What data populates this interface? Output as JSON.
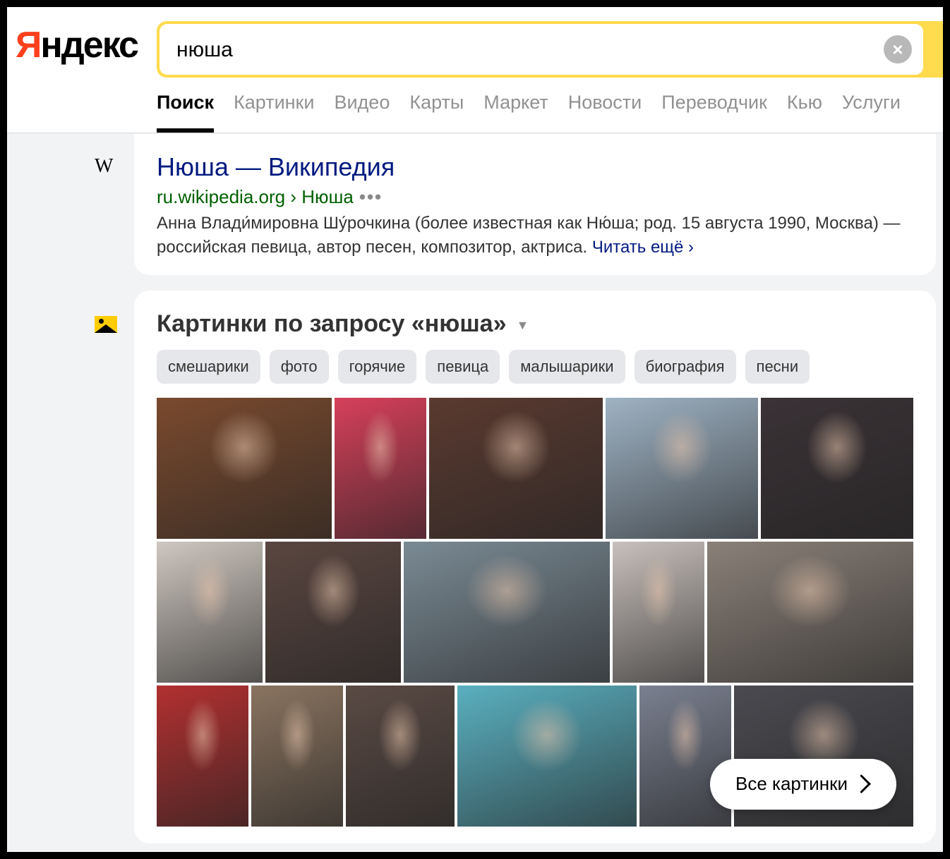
{
  "header": {
    "logo_first": "Я",
    "logo_rest": "ндекс",
    "search_value": "нюша",
    "clear_icon": "×",
    "tabs": [
      {
        "label": "Поиск",
        "active": true
      },
      {
        "label": "Картинки"
      },
      {
        "label": "Видео"
      },
      {
        "label": "Карты"
      },
      {
        "label": "Маркет"
      },
      {
        "label": "Новости"
      },
      {
        "label": "Переводчик"
      },
      {
        "label": "Кью"
      },
      {
        "label": "Услуги"
      }
    ]
  },
  "result": {
    "source_icon": "W",
    "title": "Нюша — Википедия",
    "url_host": "ru.wikipedia.org",
    "url_sep": "›",
    "url_path": "Нюша",
    "url_dots": "•••",
    "snippet": "Анна Влади́мировна Шу́рочкина (более известная как Ню́ша; род. 15 августа 1990, Москва) — российская певица, автор песен, композитор, актриса.",
    "more_label": "Читать ещё ›"
  },
  "images": {
    "heading": "Картинки по запросу «нюша»",
    "caret": "▼",
    "chips": [
      "смешарики",
      "фото",
      "горячие",
      "певица",
      "малышарики",
      "биография",
      "песни"
    ],
    "all_button": "Все картинки",
    "photo_colors": [
      "#7a4a2e",
      "#d6405a",
      "#5a3a30",
      "#9fb3c4",
      "#3a3236",
      "#cfc7c0",
      "#5a4640",
      "#7a8a94",
      "#c8c0bc",
      "#8a8078",
      "#b23030",
      "#8a7460",
      "#5a4a44",
      "#5ab0c0",
      "#7a8090",
      "#4a4a50"
    ]
  }
}
